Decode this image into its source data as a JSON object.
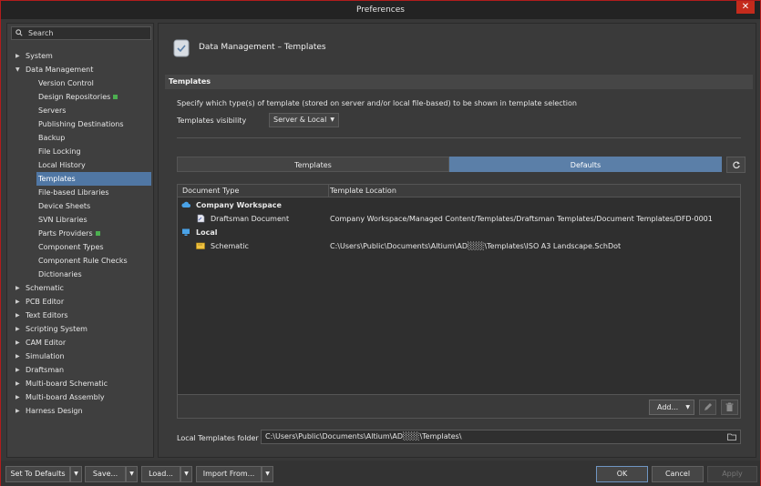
{
  "window": {
    "title": "Preferences",
    "close_glyph": "✕"
  },
  "sidebar": {
    "search_placeholder": "Search",
    "items": [
      {
        "label": "System",
        "level": 0,
        "expanded": false
      },
      {
        "label": "Data Management",
        "level": 0,
        "expanded": true
      },
      {
        "label": "Version Control",
        "level": 1
      },
      {
        "label": "Design Repositories",
        "level": 1,
        "badge": true
      },
      {
        "label": "Servers",
        "level": 1
      },
      {
        "label": "Publishing Destinations",
        "level": 1
      },
      {
        "label": "Backup",
        "level": 1
      },
      {
        "label": "File Locking",
        "level": 1
      },
      {
        "label": "Local History",
        "level": 1
      },
      {
        "label": "Templates",
        "level": 1,
        "selected": true
      },
      {
        "label": "File-based Libraries",
        "level": 1
      },
      {
        "label": "Device Sheets",
        "level": 1
      },
      {
        "label": "SVN Libraries",
        "level": 1
      },
      {
        "label": "Parts Providers",
        "level": 1,
        "badge": true
      },
      {
        "label": "Component Types",
        "level": 1
      },
      {
        "label": "Component Rule Checks",
        "level": 1
      },
      {
        "label": "Dictionaries",
        "level": 1
      },
      {
        "label": "Schematic",
        "level": 0,
        "expanded": false
      },
      {
        "label": "PCB Editor",
        "level": 0,
        "expanded": false
      },
      {
        "label": "Text Editors",
        "level": 0,
        "expanded": false
      },
      {
        "label": "Scripting System",
        "level": 0,
        "expanded": false
      },
      {
        "label": "CAM Editor",
        "level": 0,
        "expanded": false
      },
      {
        "label": "Simulation",
        "level": 0,
        "expanded": false
      },
      {
        "label": "Draftsman",
        "level": 0,
        "expanded": false
      },
      {
        "label": "Multi-board Schematic",
        "level": 0,
        "expanded": false
      },
      {
        "label": "Multi-board Assembly",
        "level": 0,
        "expanded": false
      },
      {
        "label": "Harness Design",
        "level": 0,
        "expanded": false
      }
    ]
  },
  "main": {
    "page_title": "Data Management – Templates",
    "section_title": "Templates",
    "description": "Specify which type(s) of template (stored on server and/or local file-based) to be shown in template selection",
    "visibility_label": "Templates visibility",
    "visibility_value": "Server & Local",
    "tabs": {
      "templates": "Templates",
      "defaults": "Defaults"
    },
    "grid": {
      "col_type": "Document Type",
      "col_location": "Template Location",
      "groups": [
        {
          "name": "Company Workspace",
          "rows": [
            {
              "type": "Draftsman Document",
              "location": "Company Workspace/Managed Content/Templates/Draftsman Templates/Document Templates/DFD-0001"
            }
          ]
        },
        {
          "name": "Local",
          "rows": [
            {
              "type": "Schematic",
              "location": "C:\\Users\\Public\\Documents\\Altium\\AD░░░\\Templates\\ISO A3 Landscape.SchDot"
            }
          ]
        }
      ],
      "add_label": "Add..."
    },
    "folder_label": "Local Templates folder",
    "folder_value": "C:\\Users\\Public\\Documents\\Altium\\AD░░░\\Templates\\"
  },
  "bottom": {
    "set_defaults": "Set To Defaults",
    "save": "Save...",
    "load": "Load...",
    "import": "Import From...",
    "ok": "OK",
    "cancel": "Cancel",
    "apply": "Apply"
  },
  "colors": {
    "accent": "#5b7fa8",
    "selected": "#5077a4",
    "close": "#c42b1c",
    "badge": "#4caf50"
  }
}
